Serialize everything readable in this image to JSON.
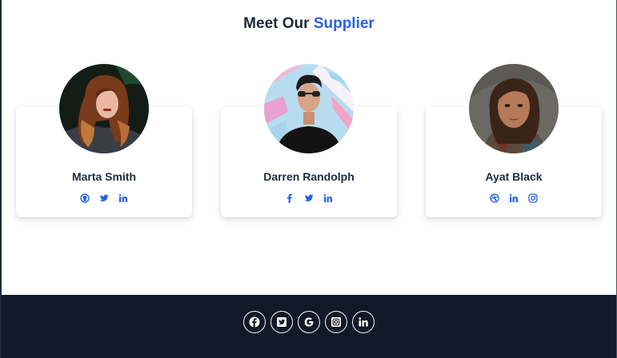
{
  "header": {
    "title_prefix": "Meet Our",
    "title_accent": "Supplier"
  },
  "colors": {
    "accent": "#2563eb",
    "text": "#1f2937",
    "footer_bg": "#111827"
  },
  "suppliers": [
    {
      "name": "Marta Smith",
      "socials": [
        "github-icon",
        "twitter-icon",
        "linkedin-icon"
      ]
    },
    {
      "name": "Darren Randolph",
      "socials": [
        "facebook-icon",
        "twitter-icon",
        "linkedin-icon"
      ]
    },
    {
      "name": "Ayat Black",
      "socials": [
        "dribbble-icon",
        "linkedin-icon",
        "instagram-icon"
      ]
    }
  ],
  "footer": {
    "icons": [
      "facebook-icon",
      "twitter-icon",
      "google-icon",
      "instagram-icon",
      "linkedin-icon"
    ]
  }
}
